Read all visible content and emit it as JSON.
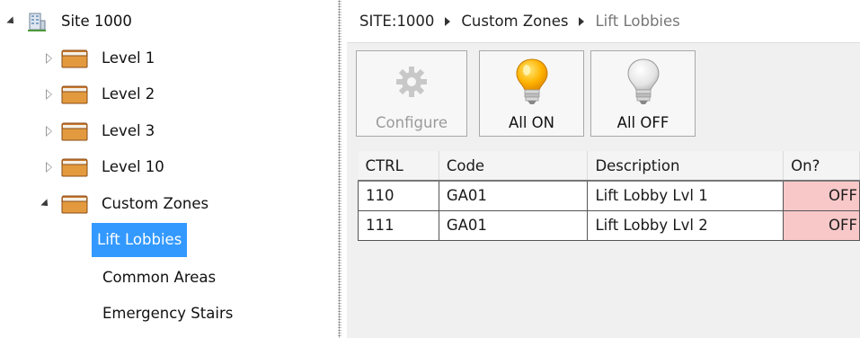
{
  "tree": {
    "root": {
      "label": "Site 1000",
      "icon": "building-icon"
    },
    "items": [
      {
        "label": "Level 1",
        "icon": "folder-icon"
      },
      {
        "label": "Level 2",
        "icon": "folder-icon"
      },
      {
        "label": "Level 3",
        "icon": "folder-icon"
      },
      {
        "label": "Level 10",
        "icon": "folder-icon"
      },
      {
        "label": "Custom Zones",
        "icon": "folder-icon"
      }
    ],
    "children": [
      {
        "label": "Lift Lobbies",
        "selected": true
      },
      {
        "label": "Common Areas"
      },
      {
        "label": "Emergency Stairs"
      }
    ],
    "selection_color": "#3399ff"
  },
  "breadcrumb": [
    "SITE:1000",
    "Custom Zones",
    "Lift Lobbies"
  ],
  "toolbar": {
    "configure_label": "Configure",
    "all_on_label": "All ON",
    "all_off_label": "All OFF"
  },
  "grid": {
    "columns": [
      "CTRL",
      "Code",
      "Description",
      "On?"
    ],
    "rows": [
      {
        "ctrl": "110",
        "code": "GA01",
        "description": "Lift Lobby Lvl 1",
        "on": "OFF"
      },
      {
        "ctrl": "111",
        "code": "GA01",
        "description": "Lift Lobby Lvl 2",
        "on": "OFF"
      }
    ],
    "off_color": "#f8c8c8"
  }
}
